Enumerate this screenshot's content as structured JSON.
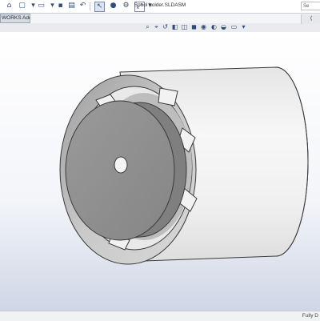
{
  "window": {
    "doc_title": "Spool holder.SLDASM"
  },
  "search": {
    "placeholder": "Se"
  },
  "command_manager": {
    "active_tab": "WORKS Add-Ins"
  },
  "statusbar": {
    "status": "Fully D"
  },
  "icons": {
    "toolbar": [
      "home-icon",
      "new-file-icon",
      "open-file-icon",
      "save-icon",
      "print-icon",
      "undo-icon",
      "select-icon",
      "rebuild-icon",
      "options-icon",
      "fullscreen-icon",
      "dropdown-icon"
    ],
    "heads_up": [
      "search-icon",
      "zoom-area-icon",
      "previous-view-icon",
      "section-view-icon",
      "view-orientation-icon",
      "display-style-icon",
      "hide-show-icon",
      "edit-appearance-icon",
      "scene-icon",
      "view-settings-icon",
      "monitor-icon"
    ]
  },
  "colors": {
    "model_body": "#e8e8e8",
    "model_edge": "#3a3a3a",
    "hub": "#8f8f8f",
    "viewport_top": "#ffffff",
    "viewport_bottom": "#cfd6e6"
  }
}
